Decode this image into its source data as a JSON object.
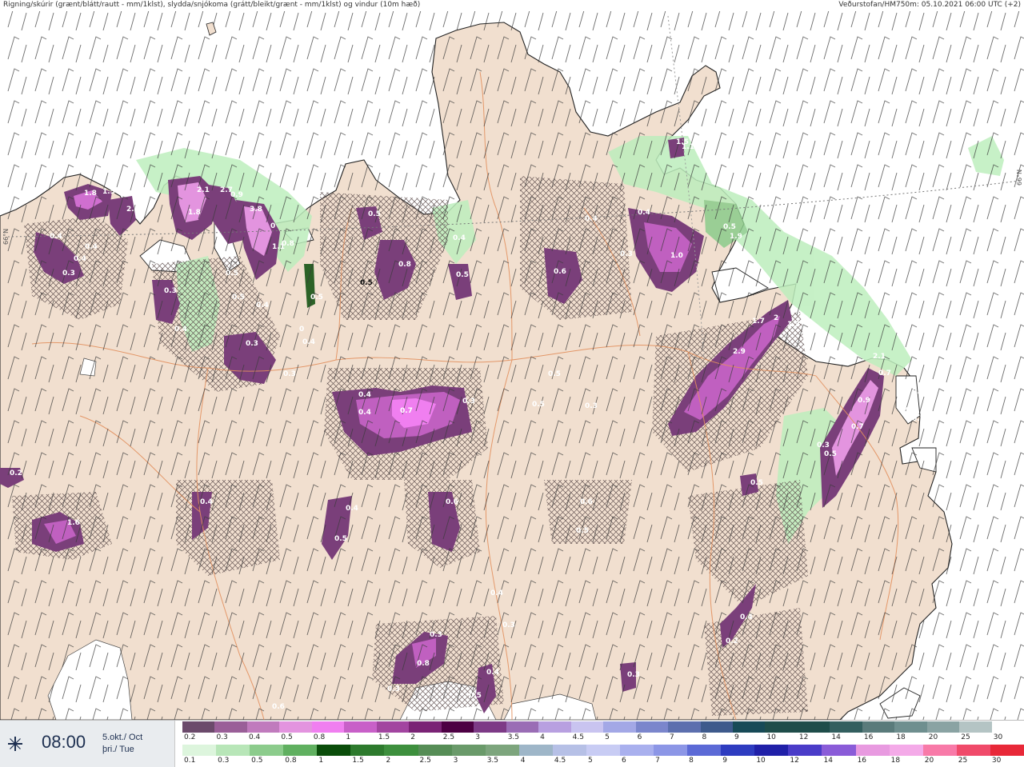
{
  "header": {
    "title": "Rigning/skúrir (grænt/blátt/rautt - mm/1klst), slydda/snjókoma (grátt/bleikt/grænt - mm/1klst) og vindur (10m hæð)",
    "source": "Veðurstofan/HM750m: 05.10.2021 06:00 UTC (+2)"
  },
  "map": {
    "latitude_label": "66°N",
    "colors": {
      "sea": "#ffffff",
      "land": "#f1dfcf",
      "roads": "#e2905e",
      "coast": "#222222"
    },
    "precip_labels": [
      "0.4",
      "1.8",
      "1.5",
      "2.6",
      "0.4",
      "0.3",
      "0.4",
      "2",
      "1.8",
      "2.1",
      "2.7",
      "0.9",
      "3.8",
      "0",
      "1.1",
      "0.8",
      "0.3",
      "0.4",
      "0.5",
      "0.5",
      "0.4",
      "0.3",
      "0.3",
      "0.5",
      "0",
      "0.4",
      "0.5",
      "0.8",
      "0.5",
      "0.5",
      "0.4",
      "0.4",
      "0.7",
      "0.4",
      "0.3",
      "0.5",
      "0.6",
      "0.4",
      "0.3",
      "0.5",
      "0.6",
      "0.4",
      "0.5",
      "0.4",
      "1.6",
      "0.2",
      "1.0",
      "0.3",
      "0.4",
      "0.5",
      "1.9",
      "1.5",
      "1.1",
      "1.7",
      "2",
      "2.9",
      "1.3",
      "2.1",
      "0.7",
      "0.9",
      "0.7",
      "0.6",
      "0.9",
      "0.7",
      "0.3",
      "0.5",
      "0.5",
      "0.6",
      "0.5",
      "0.3",
      "0.8",
      "0.3",
      "0.6",
      "0.4",
      "0.3",
      "0.4",
      "0.5",
      "0.3",
      "0.2",
      "0.4"
    ]
  },
  "time": {
    "clock": "08:00",
    "date_line1": "5.okt./ Oct",
    "date_line2": "þri./ Tue",
    "icon": "sleet-icon"
  },
  "legend": {
    "snow": {
      "labels": [
        "0.2",
        "0.3",
        "0.4",
        "0.5",
        "0.8",
        "1",
        "1.5",
        "2",
        "2.5",
        "3",
        "3.5",
        "4",
        "4.5",
        "5",
        "6",
        "7",
        "8",
        "9",
        "10",
        "12",
        "14",
        "16",
        "18",
        "20",
        "25",
        "30"
      ],
      "colors": [
        "#6b4a6b",
        "#9a5f98",
        "#c07bbd",
        "#e394df",
        "#f07ff0",
        "#c860c8",
        "#a245a0",
        "#7a2375",
        "#4d0043",
        "#7d3a86",
        "#9a6db5",
        "#b8a0e0",
        "#c9c4f0",
        "#a3a8e6",
        "#7b86cc",
        "#5c6fae",
        "#3e5a8c",
        "#174a57",
        "#1f4d4a",
        "#1f4d4a",
        "#335f5f",
        "#5a7b7b",
        "#6f8f8f",
        "#8aa3a3",
        "#b4c4c4",
        "#ffffff"
      ]
    },
    "rain": {
      "labels": [
        "0.1",
        "0.3",
        "0.5",
        "0.8",
        "1",
        "1.5",
        "2",
        "2.5",
        "3",
        "3.5",
        "4",
        "4.5",
        "5",
        "6",
        "7",
        "8",
        "9",
        "10",
        "12",
        "14",
        "16",
        "18",
        "20",
        "25",
        "30"
      ],
      "colors": [
        "#ddf5dd",
        "#b8e6b8",
        "#8ccc8c",
        "#60b060",
        "#0a4d0a",
        "#2d7a2d",
        "#3d8f3d",
        "#568d56",
        "#6a9a6a",
        "#7da57d",
        "#9eb6c8",
        "#b6c0e6",
        "#c8ccf4",
        "#a9b0ee",
        "#8c96e6",
        "#5c6ad6",
        "#2e3cc0",
        "#2020a8",
        "#4a3cc8",
        "#8a5cd8",
        "#e89ae0",
        "#f4aae8",
        "#f87aa8",
        "#f04a6a",
        "#e82838"
      ]
    }
  }
}
